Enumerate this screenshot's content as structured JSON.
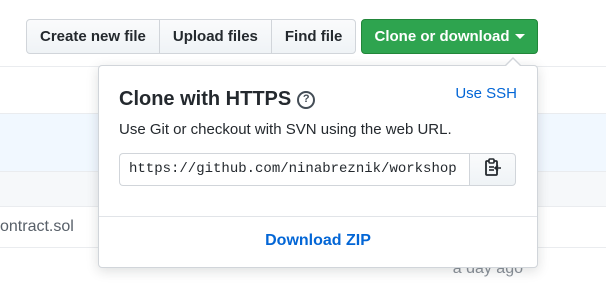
{
  "toolbar": {
    "create_new_file": "Create new file",
    "upload_files": "Upload files",
    "find_file": "Find file",
    "clone_or_download": "Clone or download"
  },
  "files": {
    "rows": [
      {
        "name": "",
        "age": ""
      },
      {
        "name": "",
        "age": ""
      },
      {
        "name": "",
        "age": ""
      },
      {
        "name": "ontract.sol",
        "age": ""
      },
      {
        "name": "",
        "age": "a day ago"
      }
    ]
  },
  "clone_panel": {
    "title": "Clone with HTTPS",
    "help_glyph": "?",
    "use_ssh_label": "Use SSH",
    "description": "Use Git or checkout with SVN using the web URL.",
    "url_value": "https://github.com/ninabreznik/workshop",
    "download_zip_label": "Download ZIP"
  },
  "colors": {
    "accent_green": "#2ea44f",
    "link_blue": "#0366d6",
    "selected_row": "#f1f8ff"
  },
  "icons": [
    "help-icon",
    "caret-down-icon",
    "clipboard-icon"
  ]
}
